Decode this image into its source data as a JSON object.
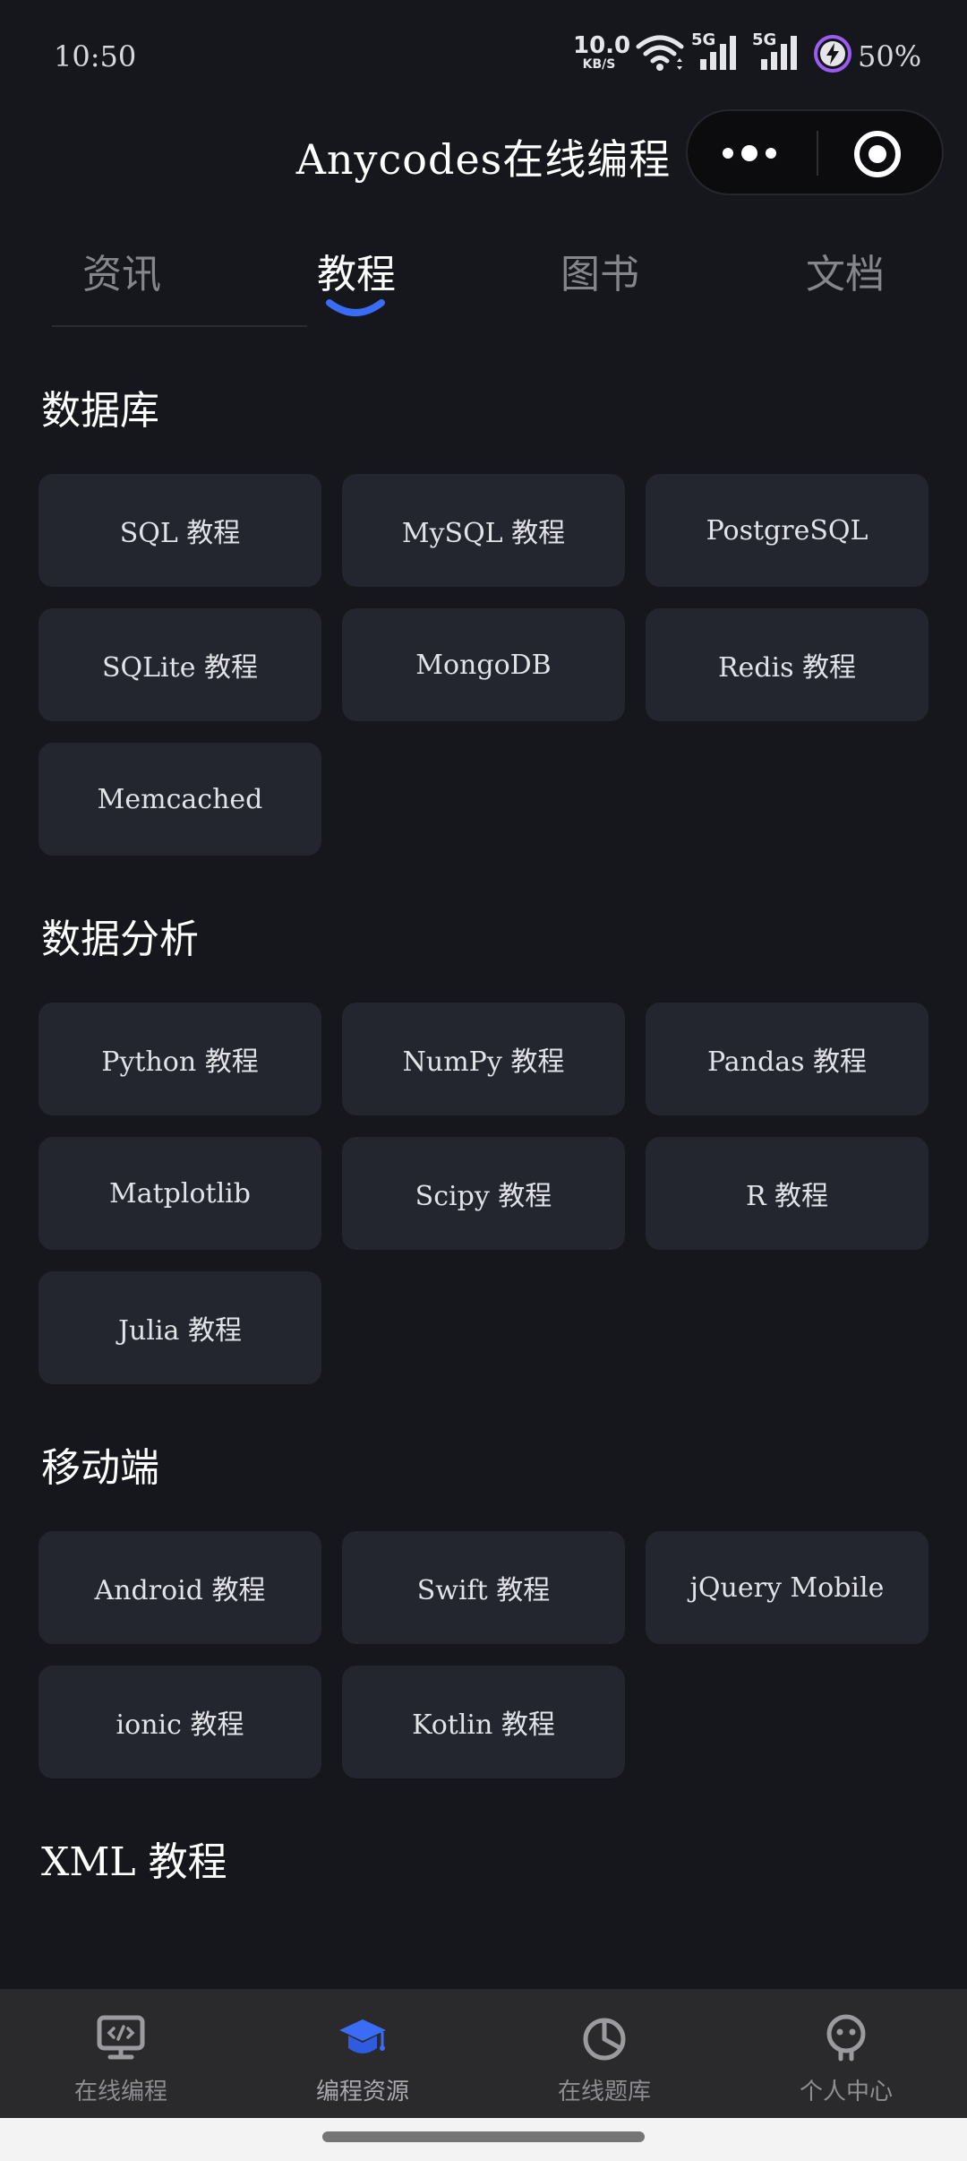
{
  "status_bar": {
    "time": "10:50",
    "net_speed_value": "10.0",
    "net_speed_unit": "KB/S",
    "signal_1_label": "5G",
    "signal_2_label": "5G",
    "battery_percent": "50%"
  },
  "header": {
    "title": "Anycodes在线编程"
  },
  "tabs": [
    {
      "label": "资讯",
      "active": false
    },
    {
      "label": "教程",
      "active": true
    },
    {
      "label": "图书",
      "active": false
    },
    {
      "label": "文档",
      "active": false
    }
  ],
  "sections": [
    {
      "title": "数据库",
      "items": [
        "SQL 教程",
        "MySQL 教程",
        "PostgreSQL",
        "SQLite 教程",
        "MongoDB",
        "Redis 教程",
        "Memcached"
      ]
    },
    {
      "title": "数据分析",
      "items": [
        "Python 教程",
        "NumPy 教程",
        "Pandas 教程",
        "Matplotlib",
        "Scipy 教程",
        "R 教程",
        "Julia 教程"
      ]
    },
    {
      "title": "移动端",
      "items": [
        "Android 教程",
        "Swift 教程",
        "jQuery Mobile",
        "ionic 教程",
        "Kotlin 教程"
      ]
    },
    {
      "title": "XML 教程",
      "items": []
    }
  ],
  "bottom_nav": [
    {
      "label": "在线编程",
      "icon": "monitor-code-icon",
      "active": false
    },
    {
      "label": "编程资源",
      "icon": "graduation-cap-icon",
      "active": true
    },
    {
      "label": "在线题库",
      "icon": "pie-chart-icon",
      "active": false
    },
    {
      "label": "个人中心",
      "icon": "robot-face-icon",
      "active": false
    }
  ],
  "colors": {
    "background": "#16171c",
    "card": "#23262f",
    "accent": "#3b6cf6",
    "nav_background": "#2a2a2d"
  }
}
